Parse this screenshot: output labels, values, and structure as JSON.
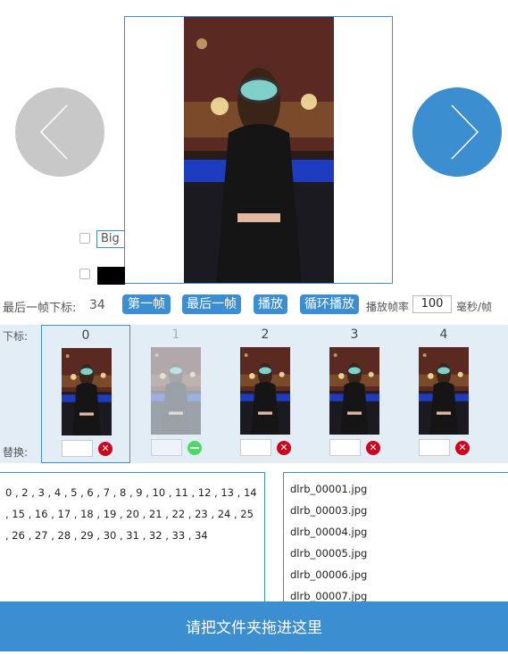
{
  "controls": {
    "big_label": "Big",
    "last_frame_label": "最后一帧下标:",
    "last_frame_value": "34",
    "btn_first": "第一帧",
    "btn_last": "最后一帧",
    "btn_play": "播放",
    "btn_loop": "循环播放",
    "fps_label": "播放帧率",
    "fps_value": "100",
    "fps_unit": "毫秒/帧"
  },
  "strip": {
    "index_label": "下标:",
    "replace_label": "替换:",
    "frames": [
      {
        "index": "0",
        "selected": true,
        "disabled": false
      },
      {
        "index": "1",
        "selected": false,
        "disabled": true
      },
      {
        "index": "2",
        "selected": false,
        "disabled": false
      },
      {
        "index": "3",
        "selected": false,
        "disabled": false
      },
      {
        "index": "4",
        "selected": false,
        "disabled": false
      }
    ]
  },
  "sequence_text": "0 , 2 , 3 , 4 , 5 , 6 , 7 , 8 , 9 , 10 , 11 , 12 , 13 , 14 , 15 , 16 , 17 , 18 , 19 , 20 , 21 , 22 , 23 , 24 , 25 , 26 , 27 , 28 , 29 , 30 , 31 , 32 , 33 , 34",
  "files": [
    "dlrb_00001.jpg",
    "dlrb_00003.jpg",
    "dlrb_00004.jpg",
    "dlrb_00005.jpg",
    "dlrb_00006.jpg",
    "dlrb_00007.jpg"
  ],
  "drop_zone_label": "请把文件夹拖进这里",
  "colors": {
    "accent": "#3b8ed0",
    "strip_bg": "#e2edf6",
    "delete": "#d0021b",
    "enable": "#4cd964"
  },
  "icons": {
    "prev": "chevron-left-icon",
    "next": "chevron-right-icon",
    "delete": "close-circle-icon",
    "enable": "minus-circle-icon"
  }
}
